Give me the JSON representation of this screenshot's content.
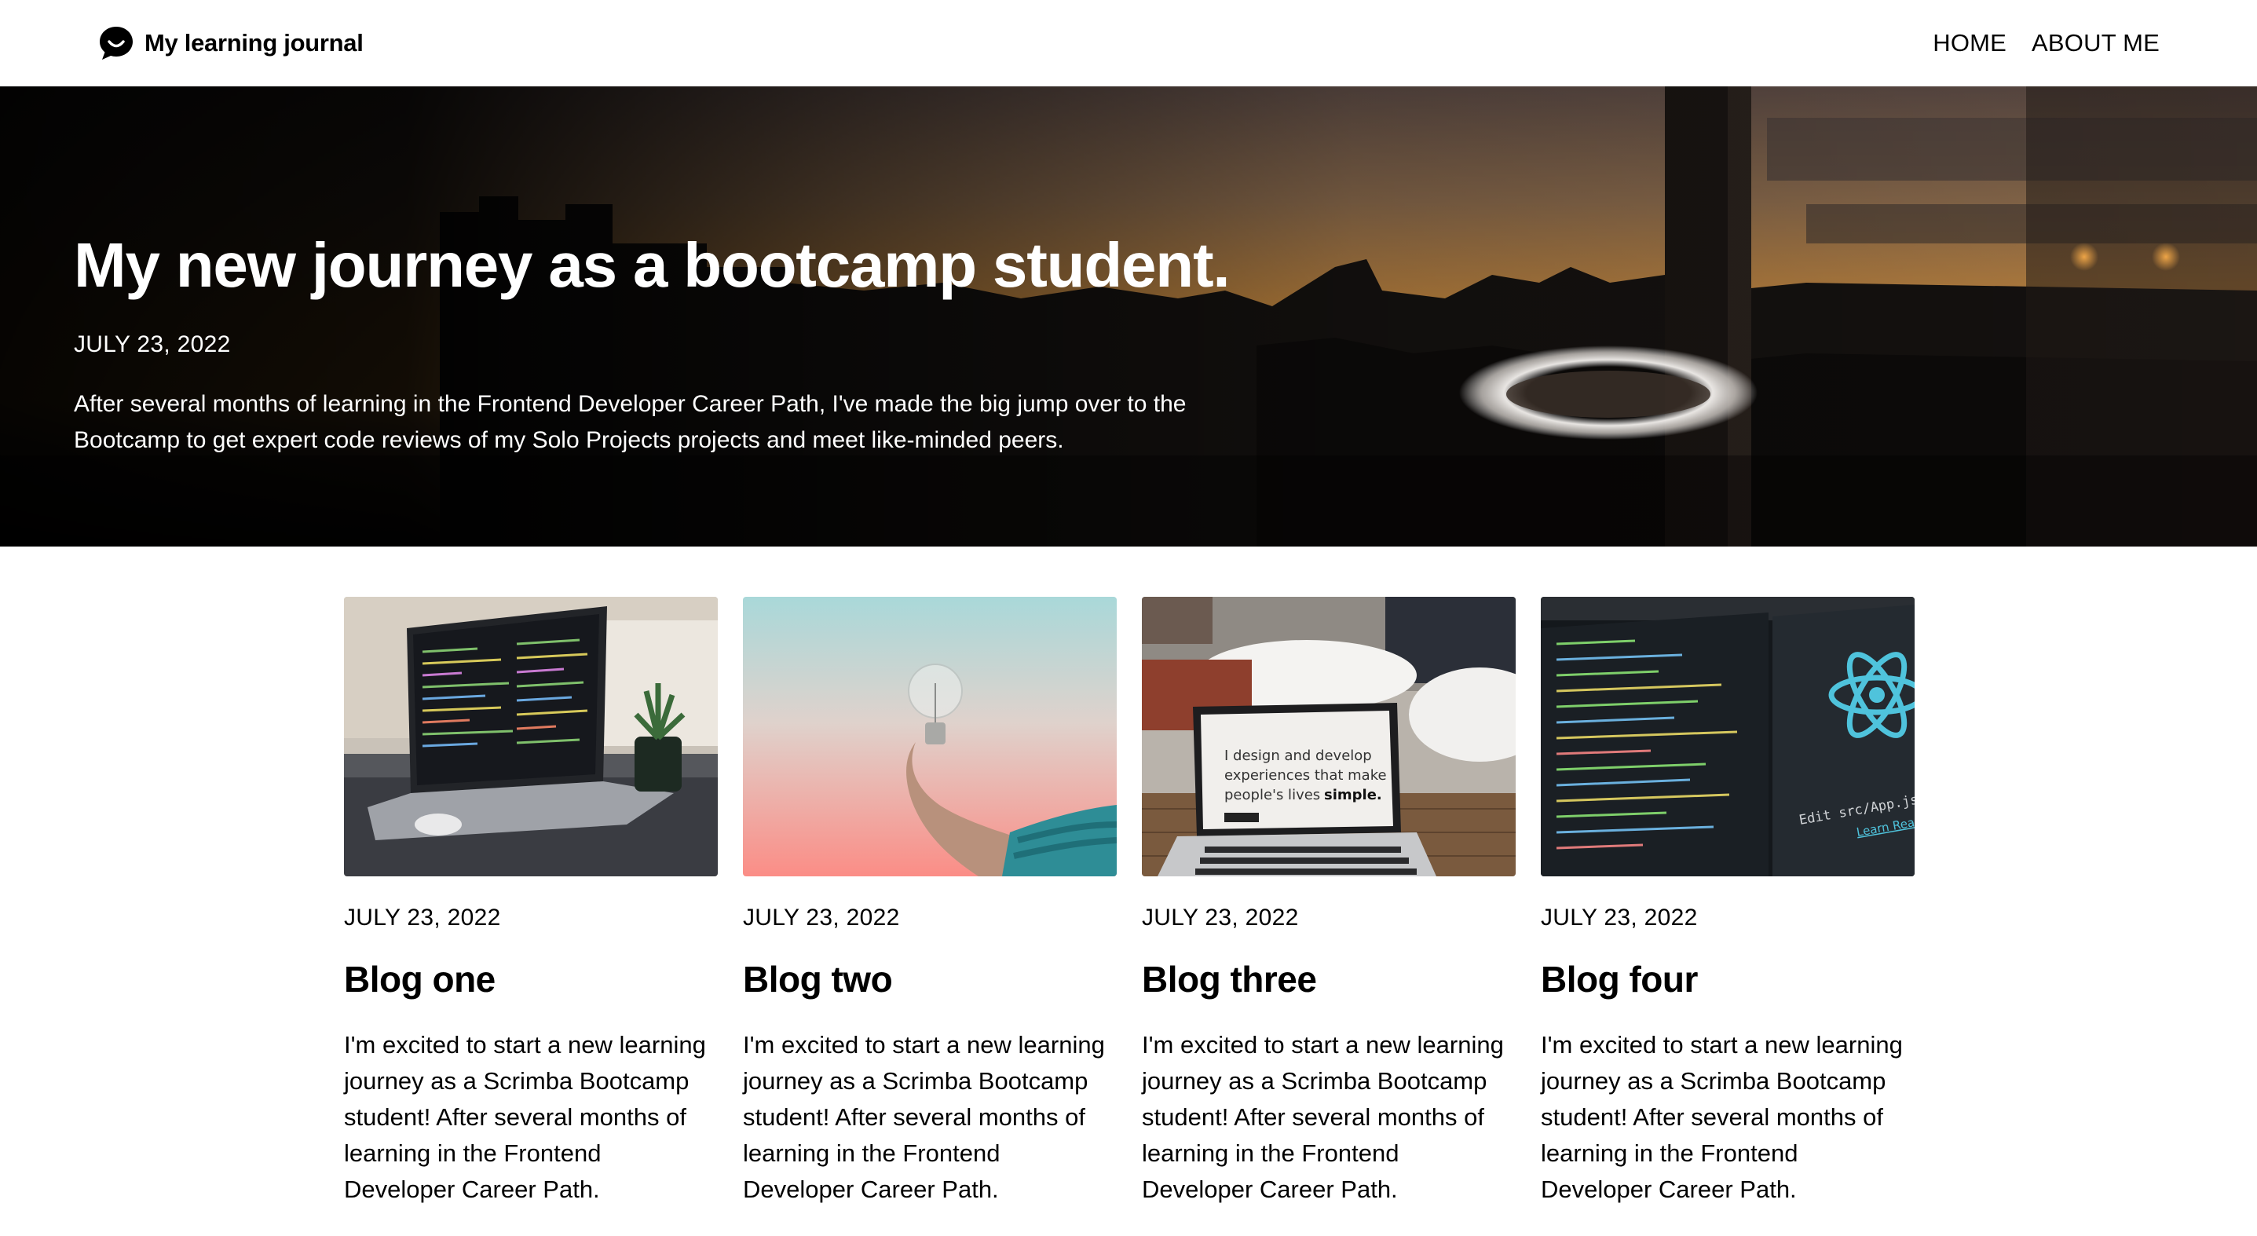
{
  "header": {
    "site_title": "My learning journal",
    "logo_icon": "chat-bubble-smile-icon",
    "nav": [
      {
        "label": "HOME"
      },
      {
        "label": "ABOUT ME"
      }
    ]
  },
  "hero": {
    "title": "My new journey as a bootcamp student.",
    "date": "JULY 23, 2022",
    "text": "After several months of learning in the Frontend Developer Career Path, I've made the big jump over to the Bootcamp to get expert code reviews of my Solo Projects projects and meet like-minded peers."
  },
  "posts": [
    {
      "date": "JULY 23, 2022",
      "title": "Blog one",
      "body": "I'm excited to start a new learning journey as a Scrimba Bootcamp student! After several months of learning in the Frontend Developer Career Path."
    },
    {
      "date": "JULY 23, 2022",
      "title": "Blog two",
      "body": "I'm excited to start a new learning journey as a Scrimba Bootcamp student! After several months of learning in the Frontend Developer Career Path."
    },
    {
      "date": "JULY 23, 2022",
      "title": "Blog three",
      "body": "I'm excited to start a new learning journey as a Scrimba Bootcamp student! After several months of learning in the Frontend Developer Career Path.",
      "image_text": [
        "I design and develop",
        "experiences that make",
        "people's lives",
        "simple."
      ]
    },
    {
      "date": "JULY 23, 2022",
      "title": "Blog four",
      "body": "I'm excited to start a new learning journey as a Scrimba Bootcamp student! After several months of learning in the Frontend Developer Career Path.",
      "image_text": [
        "Edit src/App.js and save",
        "Learn React"
      ]
    }
  ],
  "colors": {
    "text": "#000000",
    "background": "#ffffff",
    "hero_overlay": "#000000",
    "react_blue": "#4fc3dc"
  }
}
